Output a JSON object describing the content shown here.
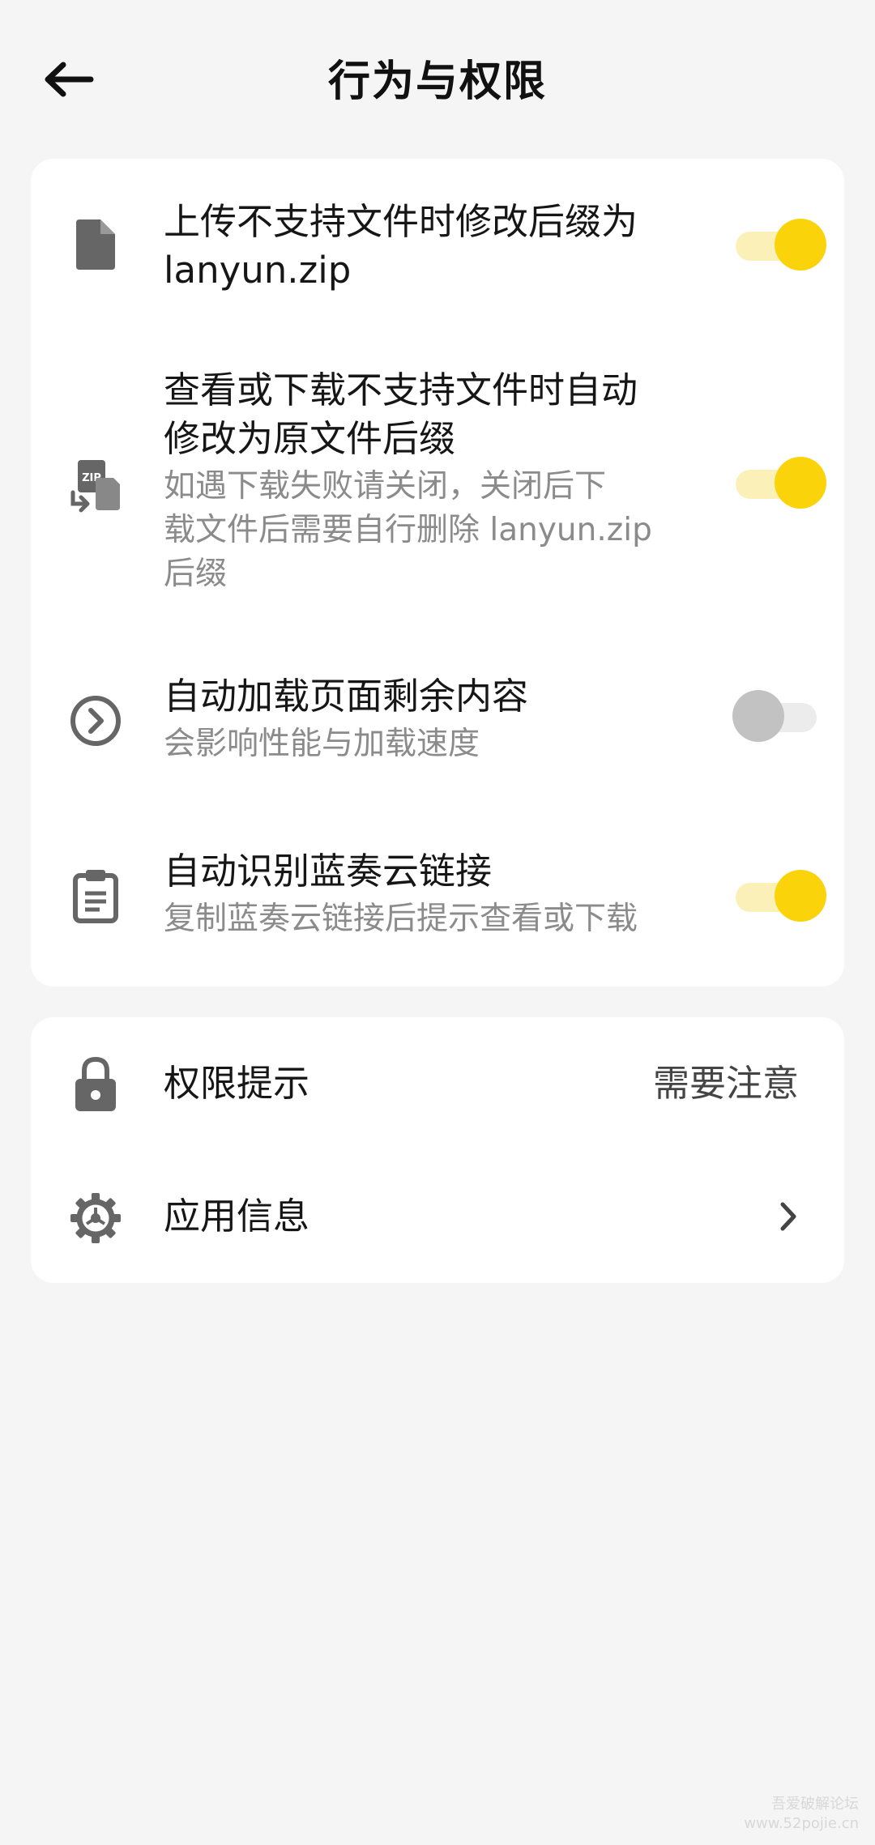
{
  "header": {
    "title": "行为与权限",
    "back_icon": "arrow-left-icon"
  },
  "behavior_settings": [
    {
      "icon": "file-icon",
      "title_lines": [
        "上传不支持文件时修改后缀为",
        "lanyun.zip"
      ],
      "subtitle_lines": [],
      "toggle": "on"
    },
    {
      "icon": "zip-file-convert-icon",
      "title_lines": [
        "查看或下载不支持文件时自动",
        "修改为原文件后缀"
      ],
      "subtitle_lines": [
        "如遇下载失败请关闭，关闭后下",
        "载文件后需要自行删除 lanyun.zip",
        "后缀"
      ],
      "toggle": "on"
    },
    {
      "icon": "chevron-circle-icon",
      "title_lines": [
        "自动加载页面剩余内容"
      ],
      "subtitle_lines": [
        "会影响性能与加载速度"
      ],
      "toggle": "off"
    },
    {
      "icon": "clipboard-icon",
      "title_lines": [
        "自动识别蓝奏云链接"
      ],
      "subtitle_lines": [
        "复制蓝奏云链接后提示查看或下载"
      ],
      "toggle": "on"
    }
  ],
  "info_settings": {
    "permission": {
      "icon": "lock-icon",
      "label": "权限提示",
      "value": "需要注意"
    },
    "app_info": {
      "icon": "gear-icon",
      "label": "应用信息",
      "trailing_icon": "chevron-right-icon"
    }
  },
  "watermark": {
    "line1": "吾爱破解论坛",
    "line2": "www.52pojie.cn"
  },
  "colors": {
    "toggle_on": "#fbd30a",
    "toggle_on_track": "#fbf0b8",
    "toggle_off": "#c2c2c2",
    "toggle_off_track": "#ececec",
    "background": "#f5f5f5",
    "card": "#ffffff",
    "icon": "#666666"
  }
}
